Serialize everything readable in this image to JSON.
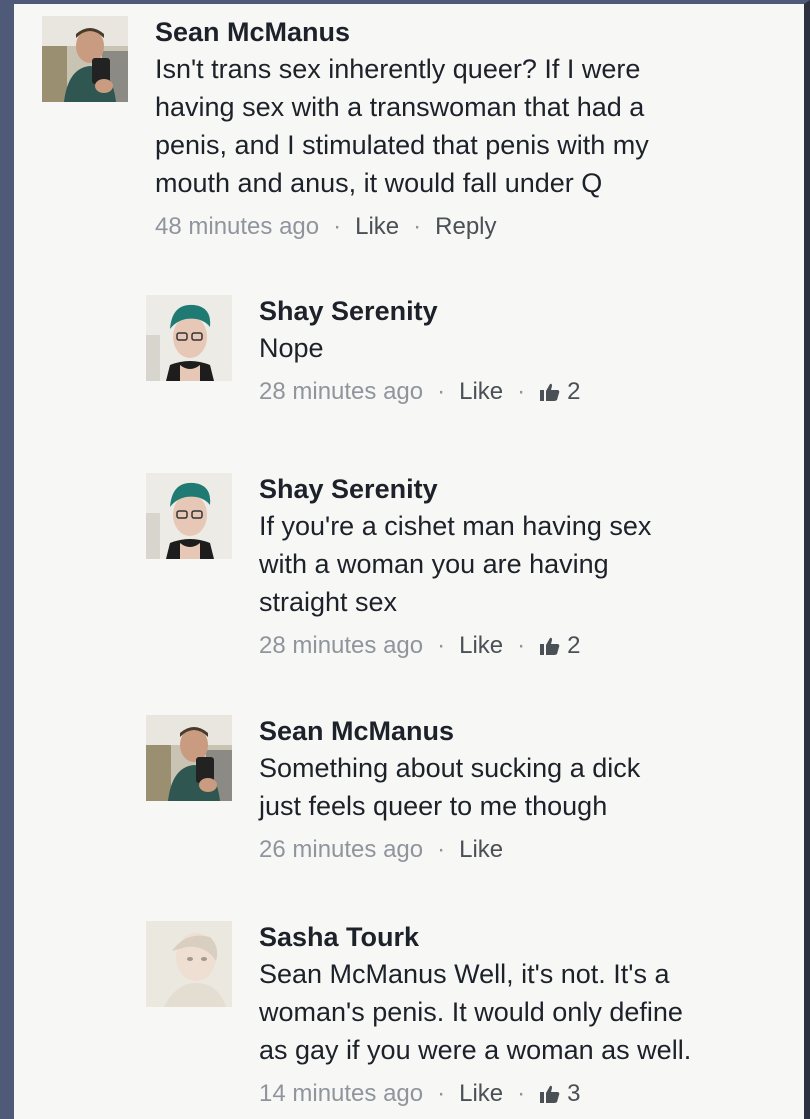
{
  "comments": [
    {
      "author": "Sean McManus",
      "text_lines": [
        "Isn't trans sex inherently queer? If I were",
        "having sex with a transwoman that had a",
        "penis, and I stimulated that penis with my",
        "mouth and anus, it would fall under Q"
      ],
      "time": "48 minutes ago",
      "like_label": "Like",
      "reply_label": "Reply",
      "avatar": "sean-avatar"
    },
    {
      "author": "Shay Serenity",
      "text_lines": [
        "Nope"
      ],
      "time": "28 minutes ago",
      "like_label": "Like",
      "like_count": "2",
      "avatar": "shay-avatar"
    },
    {
      "author": "Shay Serenity",
      "text_lines": [
        "If you're a cishet man having sex",
        "with a woman you are having",
        "straight sex"
      ],
      "time": "28 minutes ago",
      "like_label": "Like",
      "like_count": "2",
      "avatar": "shay-avatar"
    },
    {
      "author": "Sean McManus",
      "text_lines": [
        "Something about sucking a dick",
        "just feels queer to me though"
      ],
      "time": "26 minutes ago",
      "like_label": "Like",
      "avatar": "sean-avatar"
    },
    {
      "author": "Sasha Tourk",
      "text_lines": [
        "Sean McManus Well, it's not. It's a",
        "woman's penis. It would only define",
        "as gay if you were a woman as well."
      ],
      "time": "14 minutes ago",
      "like_label": "Like",
      "like_count": "3",
      "avatar": "sasha-avatar"
    }
  ],
  "separator": "·",
  "colors": {
    "text": "#1d2129",
    "meta": "#90949c",
    "link": "#4b4f56",
    "frame": "#4e5a78"
  }
}
